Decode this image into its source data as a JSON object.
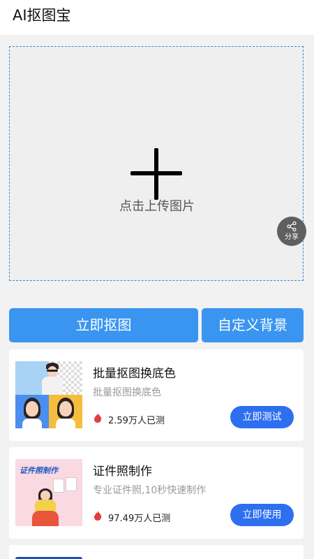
{
  "header": {
    "title": "AI抠图宝"
  },
  "upload": {
    "hint": "点击上传图片",
    "icon": "plus-icon"
  },
  "share": {
    "label": "分享",
    "icon": "share-icon"
  },
  "actions": {
    "cut_label": "立即抠图",
    "custom_bg_label": "自定义背景"
  },
  "cards": [
    {
      "title": "批量抠图换底色",
      "subtitle": "批量抠图换底色",
      "count": "2.59万人已测",
      "button": "立即测试",
      "thumb_text": ""
    },
    {
      "title": "证件照制作",
      "subtitle": "专业证件照,10秒快速制作",
      "count": "97.49万人已测",
      "button": "立即使用",
      "thumb_text": "证件照制作"
    }
  ],
  "colors": {
    "accent": "#3a95f1",
    "button": "#2e6ff0",
    "flame": "#e33d3d",
    "dashed_border": "#3a8ad6"
  }
}
